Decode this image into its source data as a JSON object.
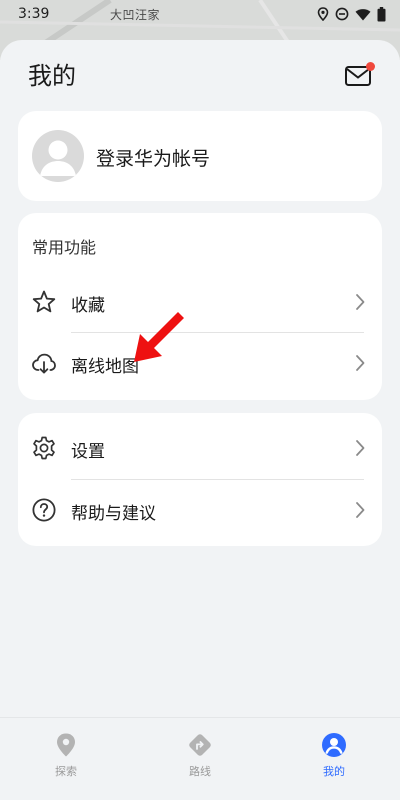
{
  "status_bar": {
    "time": "3:39",
    "icons": [
      "location-icon",
      "do-not-disturb-icon",
      "wifi-icon",
      "battery-icon"
    ]
  },
  "map": {
    "place_label": "大凹汪家"
  },
  "header": {
    "title": "我的",
    "mail_icon": "mail-icon",
    "has_unread": true
  },
  "account": {
    "login_label": "登录华为帐号"
  },
  "common_functions": {
    "title": "常用功能",
    "items": [
      {
        "label": "收藏",
        "icon": "star-icon"
      },
      {
        "label": "离线地图",
        "icon": "offline-map-cloud-icon"
      }
    ]
  },
  "settings_section": {
    "items": [
      {
        "label": "设置",
        "icon": "gear-icon"
      },
      {
        "label": "帮助与建议",
        "icon": "help-icon"
      }
    ]
  },
  "bottom_nav": {
    "items": [
      {
        "label": "探索",
        "icon": "explore-pin-icon",
        "active": false
      },
      {
        "label": "路线",
        "icon": "route-icon",
        "active": false
      },
      {
        "label": "我的",
        "icon": "profile-icon",
        "active": true
      }
    ]
  },
  "colors": {
    "accent": "#2f6bff",
    "badge": "#f0483c",
    "annotation_arrow": "#ee1111",
    "background": "#f1f3f5"
  }
}
